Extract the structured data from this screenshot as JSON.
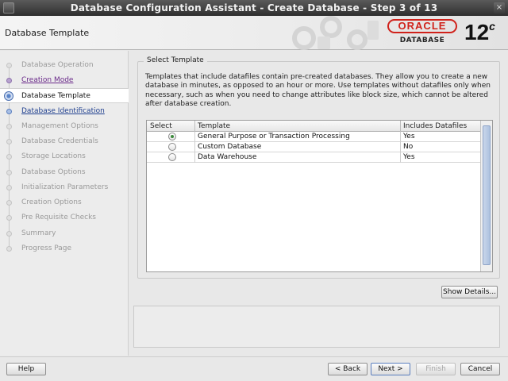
{
  "window": {
    "title": "Database Configuration Assistant - Create Database - Step 3 of 13",
    "close_glyph": "×"
  },
  "header": {
    "page_title": "Database Template",
    "logo": {
      "brand": "ORACLE",
      "product": "DATABASE",
      "version": "12",
      "version_suffix": "c"
    }
  },
  "nav": {
    "steps": [
      {
        "label": "Database Operation"
      },
      {
        "label": "Creation Mode"
      },
      {
        "label": "Database Template"
      },
      {
        "label": "Database Identification"
      },
      {
        "label": "Management Options"
      },
      {
        "label": "Database Credentials"
      },
      {
        "label": "Storage Locations"
      },
      {
        "label": "Database Options"
      },
      {
        "label": "Initialization Parameters"
      },
      {
        "label": "Creation Options"
      },
      {
        "label": "Pre Requisite Checks"
      },
      {
        "label": "Summary"
      },
      {
        "label": "Progress Page"
      }
    ]
  },
  "main": {
    "group_title": "Select Template",
    "description": "Templates that include datafiles contain pre-created databases. They allow you to create a new database in minutes, as opposed to an hour or more. Use templates without datafiles only when necessary, such as when you need to change attributes like block size, which cannot be altered after database creation.",
    "table": {
      "columns": [
        "Select",
        "Template",
        "Includes Datafiles"
      ],
      "rows": [
        {
          "template": "General Purpose or Transaction Processing",
          "datafiles": "Yes",
          "selected": true
        },
        {
          "template": "Custom Database",
          "datafiles": "No",
          "selected": false
        },
        {
          "template": "Data Warehouse",
          "datafiles": "Yes",
          "selected": false
        }
      ]
    },
    "show_details_label": "Show Details..."
  },
  "footer": {
    "help_label": "Help",
    "back_label": "< Back",
    "next_label": "Next >",
    "finish_label": "Finish",
    "cancel_label": "Cancel"
  },
  "colors": {
    "oracle_red": "#d0221b",
    "visited_link": "#6a2a8a",
    "link": "#1f3f8f"
  }
}
